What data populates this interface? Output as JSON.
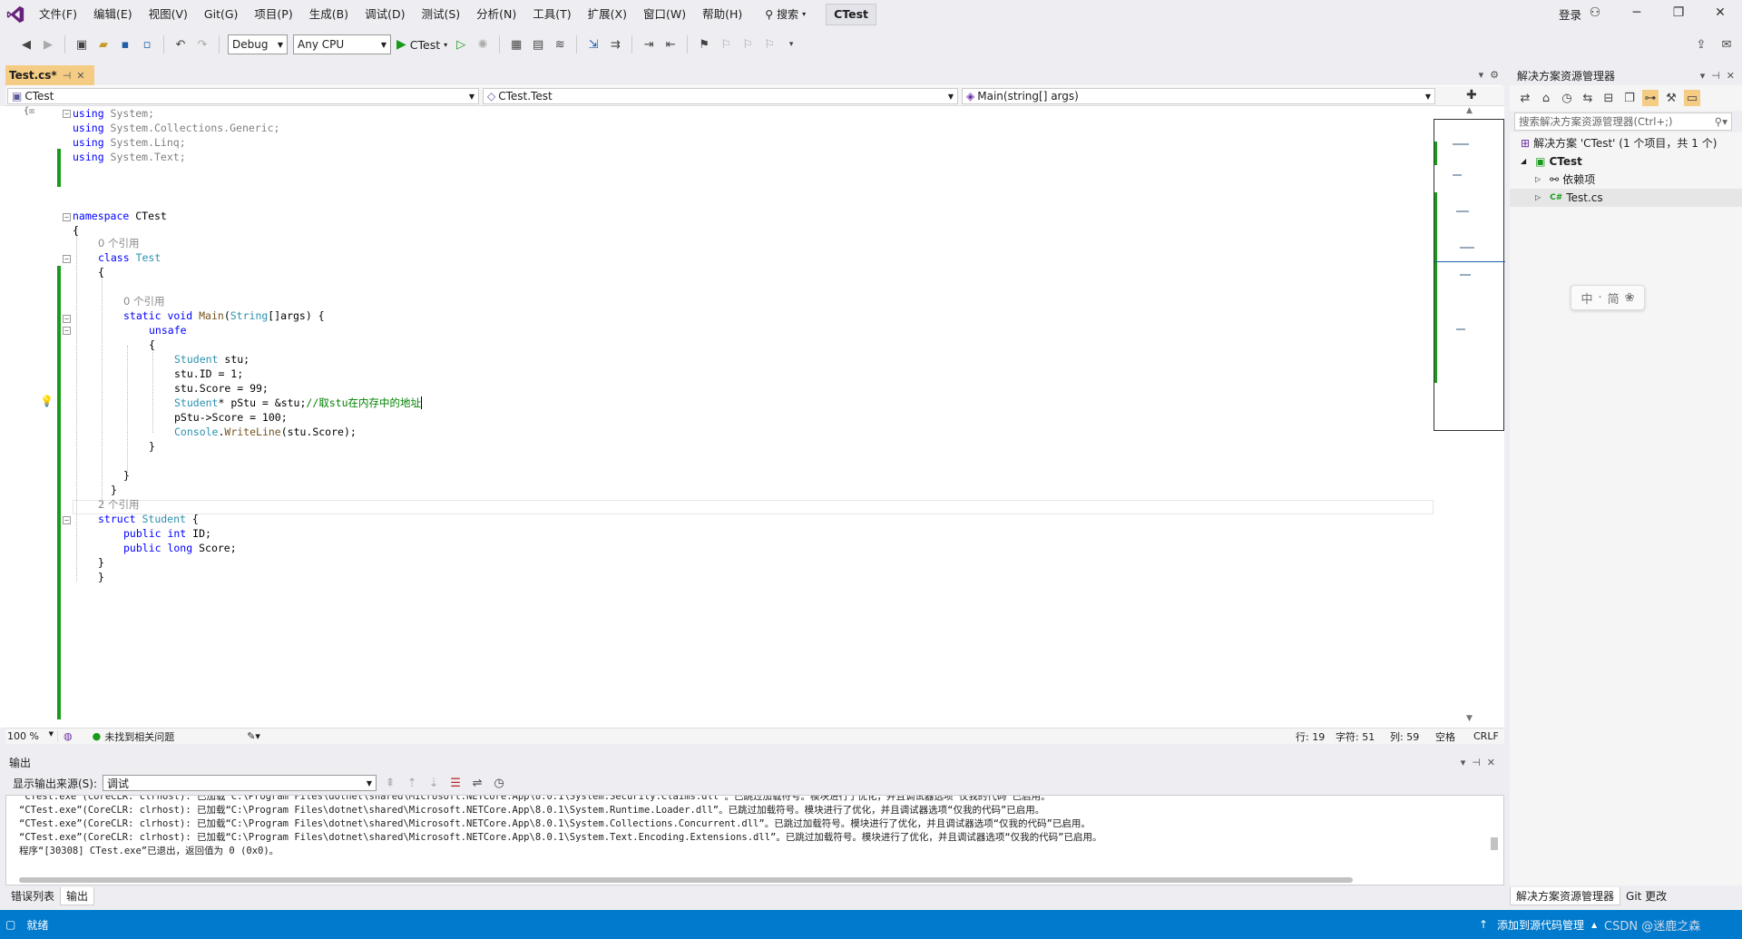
{
  "menu": {
    "items": [
      "文件(F)",
      "编辑(E)",
      "视图(V)",
      "Git(G)",
      "项目(P)",
      "生成(B)",
      "调试(D)",
      "测试(S)",
      "分析(N)",
      "工具(T)",
      "扩展(X)",
      "窗口(W)",
      "帮助(H)"
    ],
    "search_label": "搜索",
    "project_name": "CTest",
    "login_label": "登录"
  },
  "toolbar": {
    "config": "Debug",
    "platform": "Any CPU",
    "start_target": "CTest"
  },
  "editor": {
    "tab_label": "Test.cs*",
    "nav_project": "CTest",
    "nav_type": "CTest.Test",
    "nav_member": "Main(string[] args)",
    "zoom": "100 %",
    "issues": "未找到相关问题",
    "line": "行: 19",
    "char": "字符: 51",
    "col": "列: 59",
    "whitespace": "空格",
    "eol": "CRLF"
  },
  "code": {
    "l1_kw": "using",
    "l1_rest": " System;",
    "l2_kw": "using",
    "l2_rest": " System.Collections.Generic;",
    "l3_kw": "using",
    "l3_rest": " System.Linq;",
    "l4_kw": "using",
    "l4_rest": " System.Text;",
    "l6_kw": "namespace",
    "l6_rest": " CTest",
    "brace_open": "{",
    "brace_close": "}",
    "refs0_a": "0 个引用",
    "l8_kw": "class",
    "l8_type": "Test",
    "refs0_b": "0 个引用",
    "l11_kw": "static void",
    "l11_method": "Main",
    "l11_paren": "(",
    "l11_type": "String",
    "l11_rest": "[]args) {",
    "l12_kw": "unsafe",
    "l14_type": "Student",
    "l14_rest": " stu;",
    "l15": "stu.ID = 1;",
    "l16": "stu.Score = 99;",
    "l17_type": "Student",
    "l17_rest": "* pStu = &stu;",
    "l17_comment": "//取stu在内存中的地址",
    "l18": "pStu->Score = 100;",
    "l19_type": "Console",
    "l19_dot": ".",
    "l19_method": "WriteLine",
    "l19_rest": "(stu.Score);",
    "refs2": "2 个引用",
    "l23_kw": "struct",
    "l23_type": "Student",
    "l23_rest": " {",
    "l24_kw": "public int",
    "l24_rest": " ID;",
    "l25_kw": "public long",
    "l25_rest": " Score;"
  },
  "output": {
    "title": "输出",
    "source_label": "显示输出来源(S):",
    "source_value": "调试",
    "lines": [
      "“CTest.exe”(CoreCLR: clrhost): 已加载“C:\\Program Files\\dotnet\\shared\\Microsoft.NETCore.App\\8.0.1\\System.Security.Claims.dll”。已跳过加载符号。模块进行了优化，并且调试器选项“仅我的代码”已启用。",
      "“CTest.exe”(CoreCLR: clrhost): 已加载“C:\\Program Files\\dotnet\\shared\\Microsoft.NETCore.App\\8.0.1\\System.Runtime.Loader.dll”。已跳过加载符号。模块进行了优化，并且调试器选项“仅我的代码”已启用。",
      "“CTest.exe”(CoreCLR: clrhost): 已加载“C:\\Program Files\\dotnet\\shared\\Microsoft.NETCore.App\\8.0.1\\System.Collections.Concurrent.dll”。已跳过加载符号。模块进行了优化，并且调试器选项“仅我的代码”已启用。",
      "“CTest.exe”(CoreCLR: clrhost): 已加载“C:\\Program Files\\dotnet\\shared\\Microsoft.NETCore.App\\8.0.1\\System.Text.Encoding.Extensions.dll”。已跳过加载符号。模块进行了优化，并且调试器选项“仅我的代码”已启用。",
      "程序“[30308] CTest.exe”已退出，返回值为 0 (0x0)。"
    ]
  },
  "bottom_tabs": [
    "错误列表",
    "输出"
  ],
  "solution_explorer": {
    "title": "解决方案资源管理器",
    "search_placeholder": "搜索解决方案资源管理器(Ctrl+;)",
    "solution_label": "解决方案 'CTest' (1 个项目，共 1 个)",
    "project_label": "CTest",
    "deps_label": "依赖项",
    "file_label": "Test.cs",
    "file_badge": "C#",
    "ime": [
      "中",
      "·",
      "简"
    ],
    "tabs": [
      "解决方案资源管理器",
      "Git 更改"
    ]
  },
  "status": {
    "ready": "就绪",
    "add_source": "添加到源代码管理",
    "watermark": "CSDN @迷鹿之森"
  },
  "colors": {
    "accent": "#007acc",
    "tab_active": "#f5cc84",
    "change_bar": "#1a9a1a",
    "keyword": "#0000ff",
    "type": "#2b91af",
    "comment": "#008000"
  }
}
